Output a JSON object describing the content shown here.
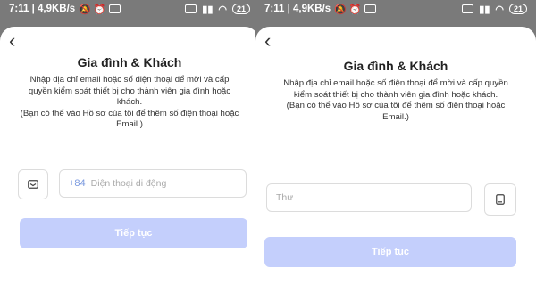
{
  "screens": [
    {
      "status": {
        "time": "7:11",
        "speed": "4,9KB/s",
        "battery": "21"
      },
      "title": "Gia đình & Khách",
      "description": "Nhập địa chỉ email hoặc số điện thoại để mời và cấp quyền kiểm soát thiết bị cho thành viên gia đình hoặc khách.\n(Bạn có thể vào Hồ sơ của tôi để thêm số điện thoại hoặc Email.)",
      "input": {
        "prefix": "+84",
        "placeholder": "Điện thoại di động"
      },
      "toggle_icon": "envelope-icon",
      "continue_label": "Tiếp tục"
    },
    {
      "status": {
        "time": "7:11",
        "speed": "4,9KB/s",
        "battery": "21"
      },
      "title": "Gia đình & Khách",
      "description": "Nhập địa chỉ email hoặc số điện thoại để mời và cấp quyền kiểm soát thiết bị cho thành viên gia đình hoặc khách.\n(Bạn có thể vào Hồ sơ của tôi để thêm số điện thoại hoặc Email.)",
      "input": {
        "placeholder": "Thư"
      },
      "toggle_icon": "phone-icon",
      "continue_label": "Tiếp tục"
    }
  ],
  "colors": {
    "button": "#c4cffc",
    "prefix": "#7b9adf",
    "backdrop": "#7a7a7a"
  }
}
